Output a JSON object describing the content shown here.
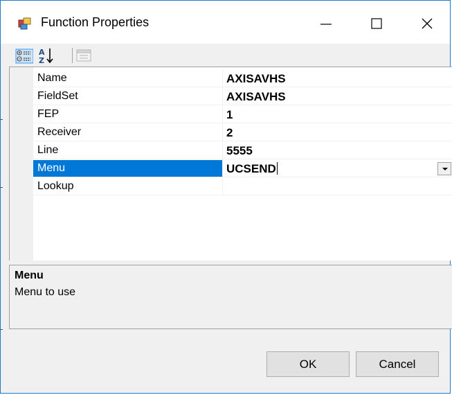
{
  "window": {
    "title": "Function Properties"
  },
  "toolbar": {
    "buttons": [
      {
        "icon": "categorized-icon",
        "enabled": true
      },
      {
        "icon": "alphabetical-sort-icon",
        "enabled": true
      },
      {
        "icon": "property-pages-icon",
        "enabled": false
      }
    ]
  },
  "properties": [
    {
      "name": "Name",
      "value": "AXISAVHS"
    },
    {
      "name": "FieldSet",
      "value": "AXISAVHS"
    },
    {
      "name": "FEP",
      "value": "1"
    },
    {
      "name": "Receiver",
      "value": "2"
    },
    {
      "name": "Line",
      "value": "5555"
    },
    {
      "name": "Menu",
      "value": "UCSEND"
    },
    {
      "name": "Lookup",
      "value": ""
    }
  ],
  "selected_property": "Menu",
  "description": {
    "title": "Menu",
    "text": "Menu to use"
  },
  "buttons": {
    "ok_label": "OK",
    "cancel_label": "Cancel"
  },
  "colors": {
    "selection": "#0078d7",
    "window_border": "#1979ca",
    "panel_background": "#f0f0f0"
  }
}
